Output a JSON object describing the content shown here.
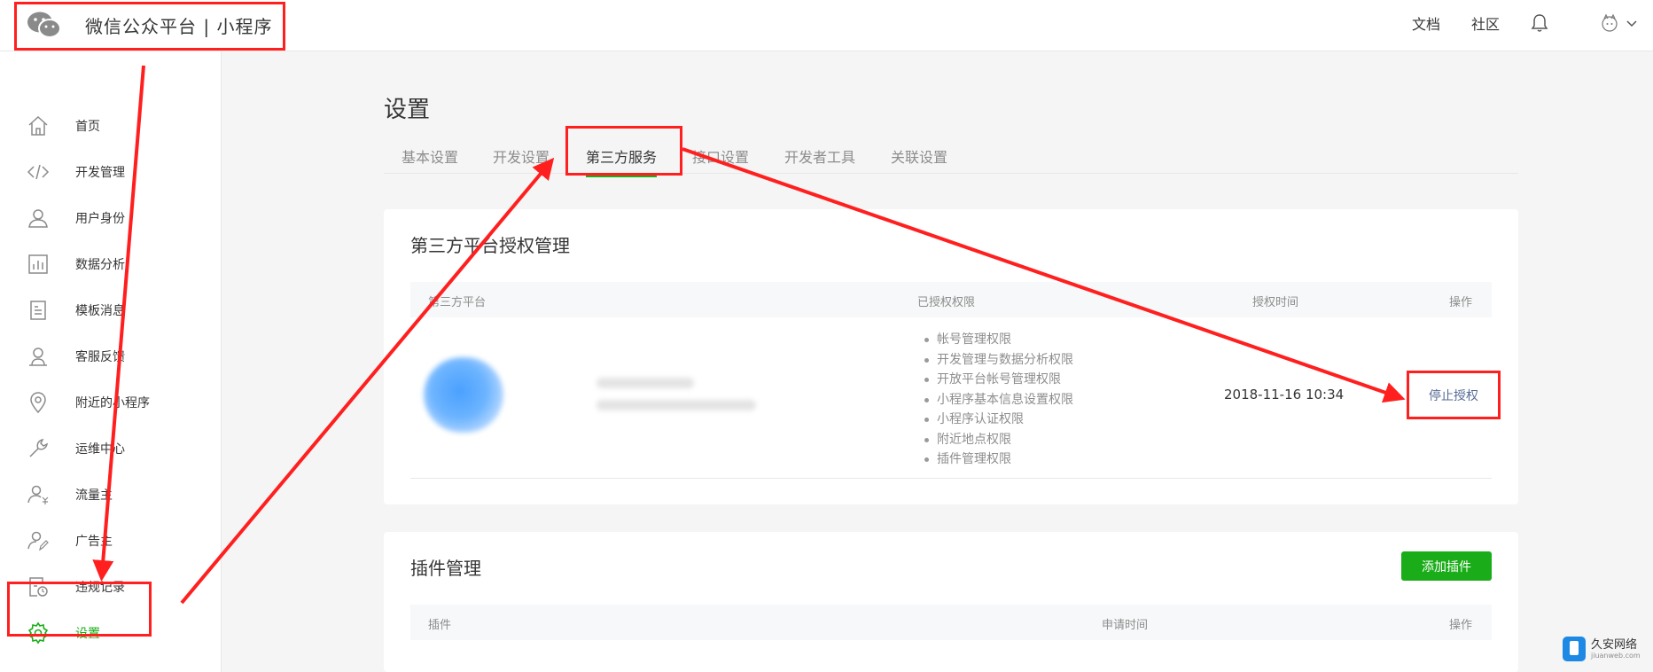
{
  "header": {
    "title": "微信公众平台 | 小程序",
    "links": {
      "docs": "文档",
      "community": "社区"
    },
    "icons": {
      "logo": "wechat-logo",
      "bell": "bell-icon",
      "avatar": "avatar",
      "chevron": "chevron-down-icon"
    }
  },
  "sidebar": {
    "items": [
      {
        "label": "首页",
        "icon": "home-icon"
      },
      {
        "label": "开发管理",
        "icon": "code-icon"
      },
      {
        "label": "用户身份",
        "icon": "user-icon"
      },
      {
        "label": "数据分析",
        "icon": "chart-icon"
      },
      {
        "label": "模板消息",
        "icon": "document-icon"
      },
      {
        "label": "客服反馈",
        "icon": "service-icon"
      },
      {
        "label": "附近的小程序",
        "icon": "location-icon"
      },
      {
        "label": "运维中心",
        "icon": "wrench-icon"
      },
      {
        "label": "流量主",
        "icon": "user-money-icon"
      },
      {
        "label": "广告主",
        "icon": "user-edit-icon"
      },
      {
        "label": "违规记录",
        "icon": "record-icon"
      },
      {
        "label": "设置",
        "icon": "gear-icon",
        "active": true
      }
    ]
  },
  "main": {
    "title": "设置",
    "tabs": [
      {
        "label": "基本设置"
      },
      {
        "label": "开发设置"
      },
      {
        "label": "第三方服务",
        "active": true
      },
      {
        "label": "接口设置"
      },
      {
        "label": "开发者工具"
      },
      {
        "label": "关联设置"
      }
    ],
    "third_party": {
      "title": "第三方平台授权管理",
      "columns": [
        "第三方平台",
        "已授权权限",
        "授权时间",
        "操作"
      ],
      "row": {
        "permissions": [
          "帐号管理权限",
          "开发管理与数据分析权限",
          "开放平台帐号管理权限",
          "小程序基本信息设置权限",
          "小程序认证权限",
          "附近地点权限",
          "插件管理权限"
        ],
        "time": "2018-11-16 10:34",
        "action": "停止授权"
      }
    },
    "plugins": {
      "title": "插件管理",
      "add_button": "添加插件",
      "columns": [
        "插件",
        "申请时间",
        "操作"
      ]
    }
  },
  "watermark": {
    "name": "久安网络",
    "url": "jiuanweb.com"
  },
  "colors": {
    "accent": "#1aad19",
    "link": "#576b95",
    "annotation": "#ff1f1f"
  }
}
